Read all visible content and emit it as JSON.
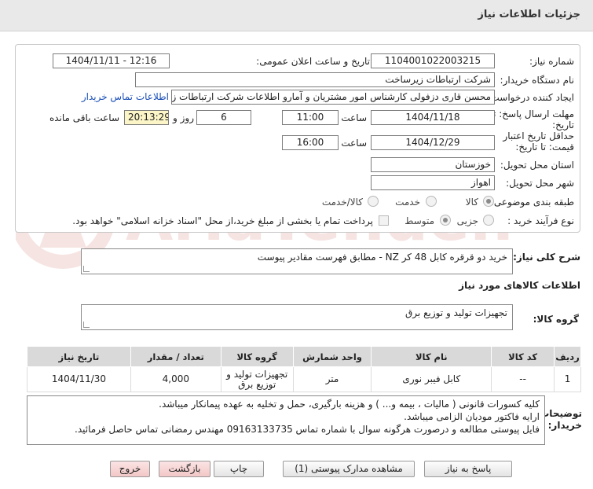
{
  "header": {
    "title": "جزئیات اطلاعات نیاز"
  },
  "form": {
    "need_number_label": "شماره نیاز:",
    "need_number": "1104001022003215",
    "announce_label": "تاریخ و ساعت اعلان عمومی:",
    "announce_value": "1404/11/11 - 12:16",
    "buyer_org_label": "نام دستگاه خریدار:",
    "buyer_org": "شرکت ارتباطات زیرساخت",
    "requester_label": "ایجاد کننده درخواست:",
    "requester": "محسن قاری دزفولی کارشناس امور مشتریان و آمارو اطلاعات شرکت ارتباطات زیرساخت",
    "buyer_contact_link": "اطلاعات تماس خریدار",
    "reply_deadline_label": "مهلت ارسال پاسخ: تا تاریخ:",
    "reply_date": "1404/11/18",
    "time_label": "ساعت",
    "reply_time": "11:00",
    "days_value": "6",
    "days_label": "روز و",
    "remaining_value": "20:13:29",
    "remaining_label": "ساعت باقی مانده",
    "validity_label": "حداقل تاریخ اعتبار قیمت: تا تاریخ:",
    "validity_date": "1404/12/29",
    "validity_time": "16:00",
    "province_label": "استان محل تحویل:",
    "province": "خوزستان",
    "city_label": "شهر محل تحویل:",
    "city": "اهواز",
    "category_label": "طبقه بندی موضوعی:",
    "category_options": [
      "کالا",
      "خدمت",
      "کالا/خدمت"
    ],
    "process_label": "نوع فرآیند خرید :",
    "process_options": [
      "جزیی",
      "متوسط"
    ],
    "payment_note": "پرداخت تمام یا بخشی از مبلغ خرید،از محل \"اسناد خزانه اسلامی\" خواهد بود."
  },
  "summary": {
    "label": "شرح کلی نیاز:",
    "text": "خرید دو قرقره کابل 48 کر NZ - مطابق فهرست مقادیر پیوست"
  },
  "goods_section": {
    "title": "اطلاعات کالاهای مورد نیاز",
    "group_label": "گروه کالا:",
    "group_value": "تجهیزات تولید و توزیع برق"
  },
  "table": {
    "headers": [
      "ردیف",
      "کد کالا",
      "نام کالا",
      "واحد شمارش",
      "گروه کالا",
      "تعداد / مقدار",
      "تاریخ نیاز"
    ],
    "rows": [
      {
        "row": "1",
        "code": "--",
        "name": "کابل فیبر نوری",
        "unit": "متر",
        "group": "تجهیزات تولید و توزیع برق",
        "qty": "4,000",
        "date": "1404/11/30"
      }
    ]
  },
  "notes": {
    "label": "توضیحات خریدار:",
    "lines": [
      "کلیه کسورات قانونی ( مالیات ، بیمه و... ) و هزینه بارگیری، حمل و تخلیه به عهده پیمانکار میباشد.",
      "ارایه فاکتور مودیان الزامی میباشد.",
      "فایل پیوستی مطالعه و درصورت هرگونه سوال با شماره تماس  09163133735 مهندس رمضانی تماس حاصل فرمائید."
    ]
  },
  "buttons": {
    "reply": "پاسخ به نیاز",
    "attachments": "مشاهده مدارک پیوستی (1)",
    "print": "چاپ",
    "back": "بازگشت",
    "exit": "خروج"
  },
  "watermark": {
    "text": "AriaTender.net"
  },
  "colors": {
    "link": "#1a4fb8",
    "highlight": "#fbf5c7",
    "table_header": "#d9d9d9",
    "watermark": "#c0392b"
  }
}
